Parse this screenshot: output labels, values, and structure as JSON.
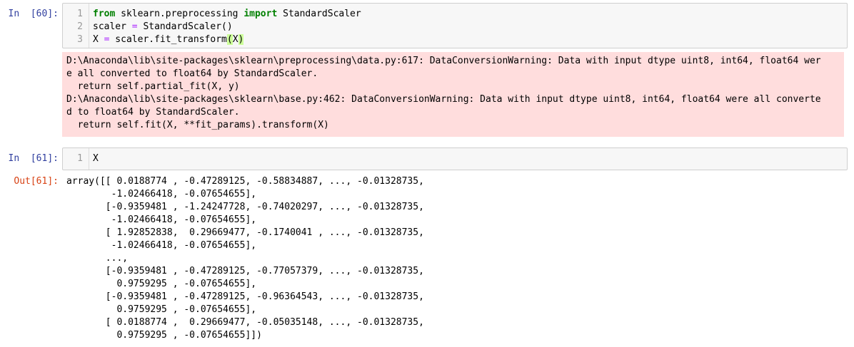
{
  "cell60": {
    "prompt": "In  [60]:",
    "lines": [
      {
        "no": "1",
        "parts": [
          {
            "t": "from",
            "c": "kw"
          },
          {
            "t": " sklearn.preprocessing ",
            "c": ""
          },
          {
            "t": "import",
            "c": "kw"
          },
          {
            "t": " StandardScaler",
            "c": ""
          }
        ]
      },
      {
        "no": "2",
        "parts": [
          {
            "t": "scaler ",
            "c": ""
          },
          {
            "t": "=",
            "c": "op"
          },
          {
            "t": " StandardScaler()",
            "c": ""
          }
        ]
      },
      {
        "no": "3",
        "parts": [
          {
            "t": "X ",
            "c": ""
          },
          {
            "t": "=",
            "c": "op"
          },
          {
            "t": " scaler.fit_transform",
            "c": ""
          },
          {
            "t": "(",
            "c": "matched"
          },
          {
            "t": "X",
            "c": ""
          },
          {
            "t": ")",
            "c": "matched"
          }
        ]
      }
    ],
    "stderr": [
      "D:\\Anaconda\\lib\\site-packages\\sklearn\\preprocessing\\data.py:617: DataConversionWarning: Data with input dtype uint8, int64, float64 wer",
      "e all converted to float64 by StandardScaler.",
      "  return self.partial_fit(X, y)",
      "D:\\Anaconda\\lib\\site-packages\\sklearn\\base.py:462: DataConversionWarning: Data with input dtype uint8, int64, float64 were all converte",
      "d to float64 by StandardScaler.",
      "  return self.fit(X, **fit_params).transform(X)"
    ]
  },
  "cell61": {
    "prompt": "In  [61]:",
    "lines": [
      {
        "no": "1",
        "parts": [
          {
            "t": "X",
            "c": ""
          }
        ]
      }
    ],
    "out_prompt": "Out[61]:",
    "output": [
      "array([[ 0.0188774 , -0.47289125, -0.58834887, ..., -0.01328735,",
      "        -1.02466418, -0.07654655],",
      "       [-0.9359481 , -1.24247728, -0.74020297, ..., -0.01328735,",
      "        -1.02466418, -0.07654655],",
      "       [ 1.92852838,  0.29669477, -0.1740041 , ..., -0.01328735,",
      "        -1.02466418, -0.07654655],",
      "       ...,",
      "       [-0.9359481 , -0.47289125, -0.77057379, ..., -0.01328735,",
      "         0.9759295 , -0.07654655],",
      "       [-0.9359481 , -0.47289125, -0.96364543, ..., -0.01328735,",
      "         0.9759295 , -0.07654655],",
      "       [ 0.0188774 ,  0.29669477, -0.05035148, ..., -0.01328735,",
      "         0.9759295 , -0.07654655]])"
    ]
  }
}
